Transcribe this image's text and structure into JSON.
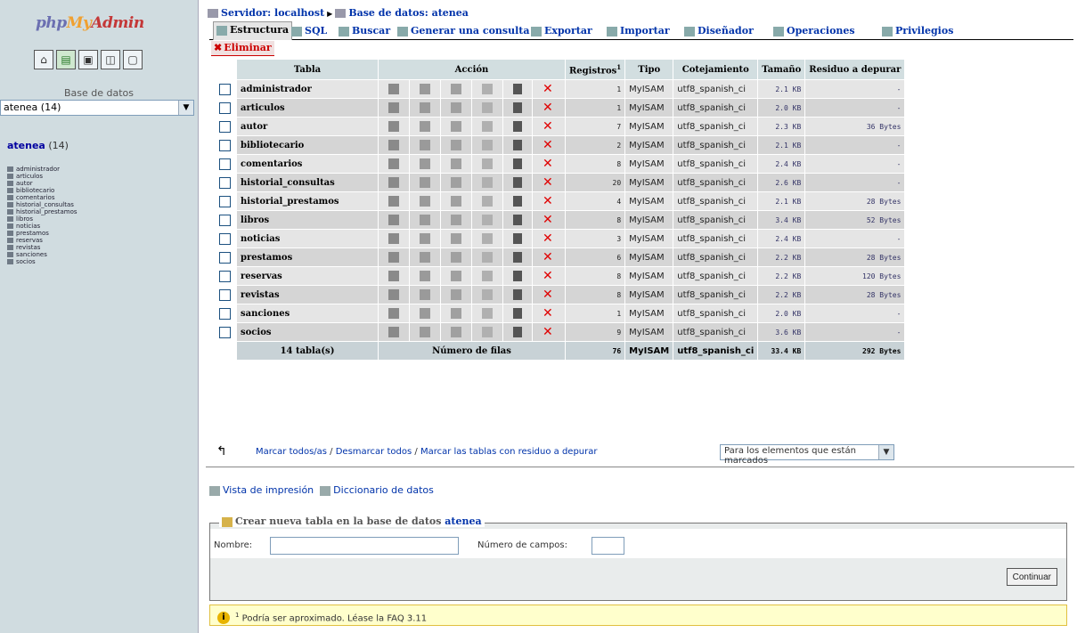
{
  "left": {
    "logo": {
      "php": "php",
      "my": "My",
      "admin": "Admin"
    },
    "db_label": "Base de datos",
    "db_select": "atenea (14)",
    "db_title": "atenea",
    "db_count": "(14)",
    "tables": [
      "administrador",
      "articulos",
      "autor",
      "bibliotecario",
      "comentarios",
      "historial_consultas",
      "historial_prestamos",
      "libros",
      "noticias",
      "prestamos",
      "reservas",
      "revistas",
      "sanciones",
      "socios"
    ]
  },
  "breadcrumb": {
    "server": "Servidor: localhost",
    "database": "Base de datos: atenea"
  },
  "tabs": [
    {
      "label": "Estructura"
    },
    {
      "label": "SQL"
    },
    {
      "label": "Buscar"
    },
    {
      "label": "Generar una consulta"
    },
    {
      "label": "Exportar"
    },
    {
      "label": "Importar"
    },
    {
      "label": "Diseñador"
    },
    {
      "label": "Operaciones"
    },
    {
      "label": "Privilegios"
    }
  ],
  "drop_tab": "Eliminar",
  "table": {
    "headers": {
      "tabla": "Tabla",
      "accion": "Acción",
      "registros": "Registros",
      "registros_sup": "1",
      "tipo": "Tipo",
      "cotejamiento": "Cotejamiento",
      "tamano": "Tamaño",
      "residuo": "Residuo a depurar"
    },
    "rows": [
      {
        "name": "administrador",
        "records": "1",
        "type": "MyISAM",
        "collation": "utf8_spanish_ci",
        "size": "2.1 KB",
        "overhead": "-"
      },
      {
        "name": "articulos",
        "records": "1",
        "type": "MyISAM",
        "collation": "utf8_spanish_ci",
        "size": "2.0 KB",
        "overhead": "-"
      },
      {
        "name": "autor",
        "records": "7",
        "type": "MyISAM",
        "collation": "utf8_spanish_ci",
        "size": "2.3 KB",
        "overhead": "36 Bytes"
      },
      {
        "name": "bibliotecario",
        "records": "2",
        "type": "MyISAM",
        "collation": "utf8_spanish_ci",
        "size": "2.1 KB",
        "overhead": "-"
      },
      {
        "name": "comentarios",
        "records": "8",
        "type": "MyISAM",
        "collation": "utf8_spanish_ci",
        "size": "2.4 KB",
        "overhead": "-"
      },
      {
        "name": "historial_consultas",
        "records": "20",
        "type": "MyISAM",
        "collation": "utf8_spanish_ci",
        "size": "2.6 KB",
        "overhead": "-"
      },
      {
        "name": "historial_prestamos",
        "records": "4",
        "type": "MyISAM",
        "collation": "utf8_spanish_ci",
        "size": "2.1 KB",
        "overhead": "28 Bytes"
      },
      {
        "name": "libros",
        "records": "8",
        "type": "MyISAM",
        "collation": "utf8_spanish_ci",
        "size": "3.4 KB",
        "overhead": "52 Bytes"
      },
      {
        "name": "noticias",
        "records": "3",
        "type": "MyISAM",
        "collation": "utf8_spanish_ci",
        "size": "2.4 KB",
        "overhead": "-"
      },
      {
        "name": "prestamos",
        "records": "6",
        "type": "MyISAM",
        "collation": "utf8_spanish_ci",
        "size": "2.2 KB",
        "overhead": "28 Bytes"
      },
      {
        "name": "reservas",
        "records": "8",
        "type": "MyISAM",
        "collation": "utf8_spanish_ci",
        "size": "2.2 KB",
        "overhead": "120 Bytes"
      },
      {
        "name": "revistas",
        "records": "8",
        "type": "MyISAM",
        "collation": "utf8_spanish_ci",
        "size": "2.2 KB",
        "overhead": "28 Bytes"
      },
      {
        "name": "sanciones",
        "records": "1",
        "type": "MyISAM",
        "collation": "utf8_spanish_ci",
        "size": "2.0 KB",
        "overhead": "-"
      },
      {
        "name": "socios",
        "records": "9",
        "type": "MyISAM",
        "collation": "utf8_spanish_ci",
        "size": "3.6 KB",
        "overhead": "-"
      }
    ],
    "totals": {
      "tables": "14 tabla(s)",
      "label": "Número de filas",
      "records": "76",
      "type": "MyISAM",
      "collation": "utf8_spanish_ci",
      "size": "33.4 KB",
      "overhead": "292 Bytes"
    }
  },
  "footer": {
    "mark_all": "Marcar todos/as",
    "unmark_all": "Desmarcar todos",
    "mark_overhead": "Marcar las tablas con residuo a depurar",
    "with_selected": "Para los elementos que están marcados",
    "print_view": "Vista de impresión",
    "data_dictionary": "Diccionario de datos"
  },
  "create_table": {
    "legend": "Crear nueva tabla en la base de datos",
    "db": "atenea",
    "name_label": "Nombre:",
    "fields_label": "Número de campos:",
    "name_value": "",
    "fields_value": "",
    "submit": "Continuar"
  },
  "notice": {
    "sup": "1",
    "text": "Podría ser aproximado. Léase la FAQ 3.11"
  }
}
